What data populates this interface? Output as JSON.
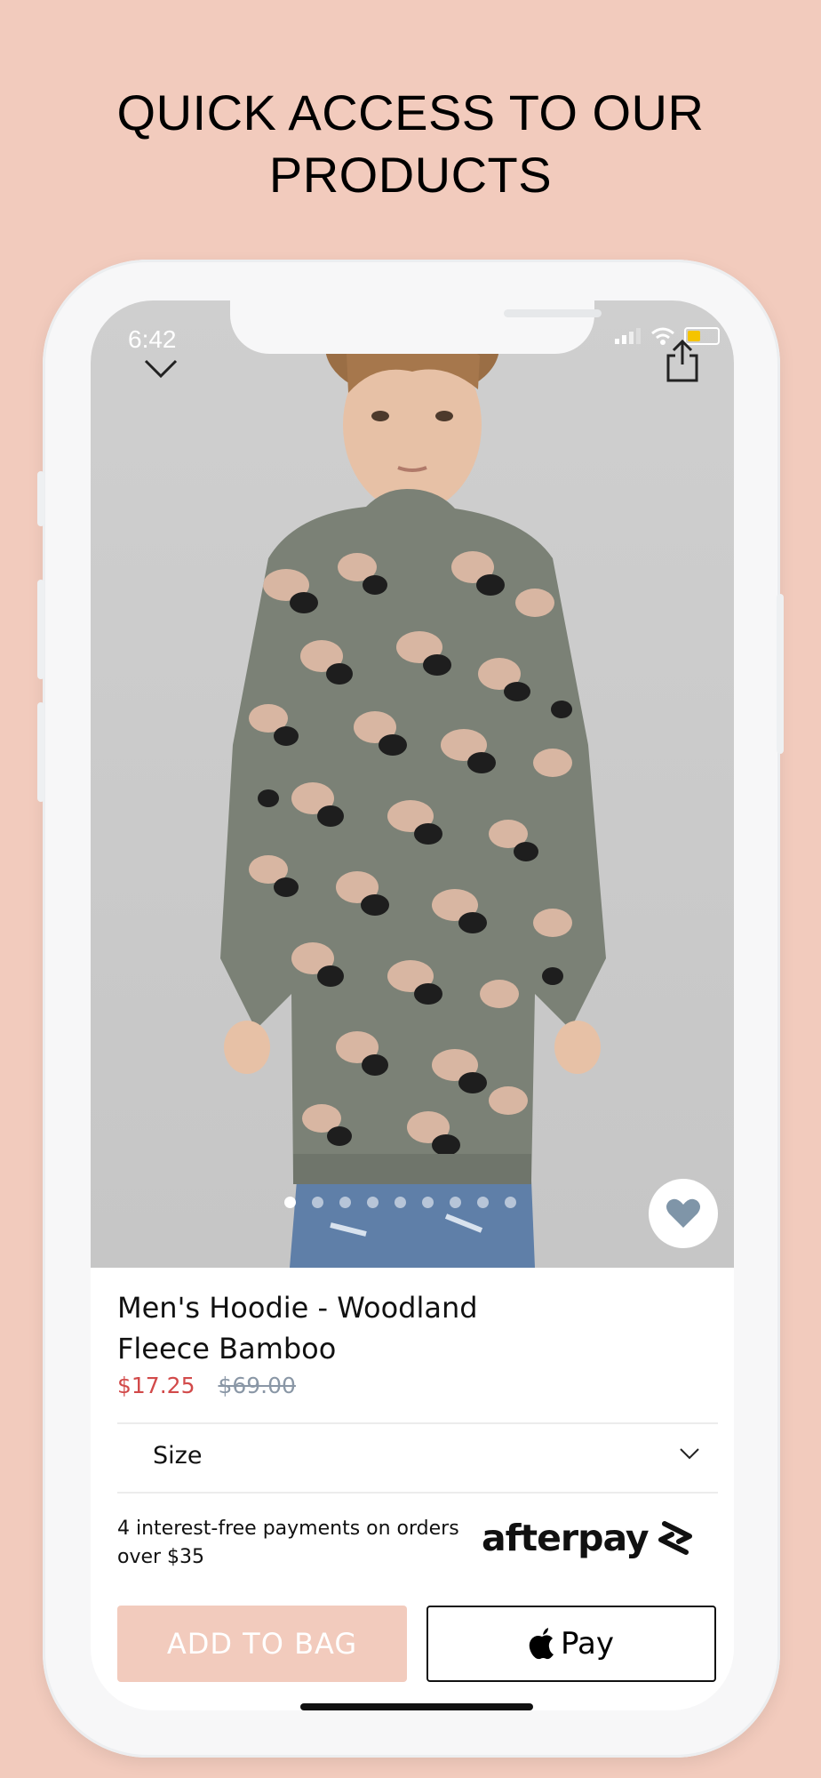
{
  "promo": {
    "line1": "QUICK ACCESS TO OUR",
    "line2": "PRODUCTS"
  },
  "status_bar": {
    "time": "6:42"
  },
  "gallery": {
    "image_count": 9,
    "active_index": 0
  },
  "product": {
    "title_line1": "Men's Hoodie - Woodland",
    "title_line2": "Fleece Bamboo",
    "sale_price": "$17.25",
    "original_price": "$69.00"
  },
  "size_selector": {
    "label": "Size"
  },
  "afterpay": {
    "text_line1": "4 interest-free payments on orders",
    "text_line2": "over $35",
    "logo_text": "afterpay"
  },
  "actions": {
    "add_to_bag": "ADD TO BAG",
    "apple_pay": "Pay"
  },
  "colors": {
    "background": "#f2cbbd",
    "sale_price": "#d24a4a",
    "original_price": "#8a97a6",
    "favorite_icon": "#7f95a8",
    "add_button": "#f2cbbd"
  },
  "icons": {
    "close": "chevron-down-icon",
    "share": "share-icon",
    "favorite": "heart-icon",
    "size_dropdown": "chevron-down-icon",
    "afterpay": "afterpay-arrows-icon",
    "apple": "apple-icon"
  }
}
